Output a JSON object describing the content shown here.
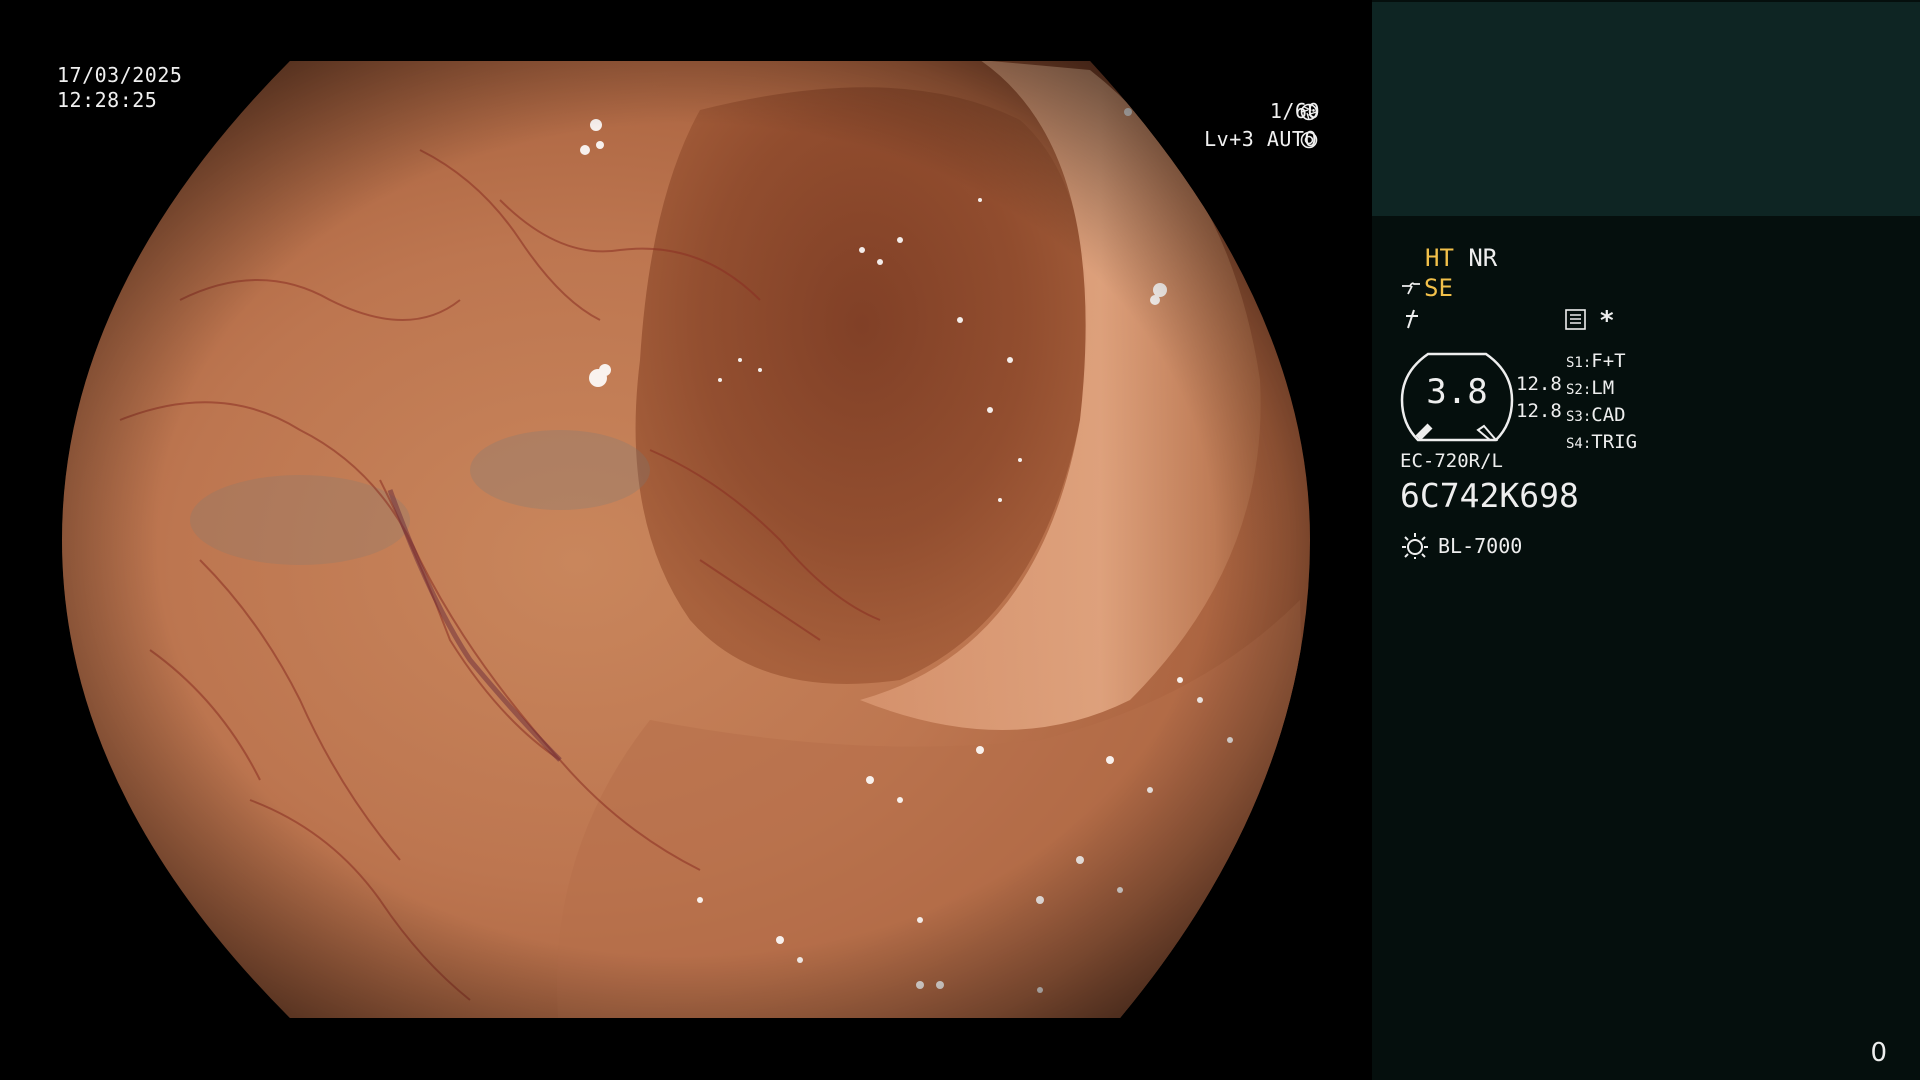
{
  "overlay": {
    "date": "17/03/2025",
    "time": "12:28:25",
    "shutter": "1/60",
    "shutter_icon": "aperture-icon",
    "level": "Lv+3",
    "exposure_mode": "AUTO",
    "exposure_icon": "iris-icon"
  },
  "status_panel": {
    "ht_label": "HT",
    "nr_label": "NR",
    "se_label": "SE",
    "gauge_value": "3.8",
    "gauge_side_1": "12.8",
    "gauge_side_2": "12.8",
    "scope_presets": [
      {
        "key": "S1:",
        "value": "F+T"
      },
      {
        "key": "S2:",
        "value": "LM"
      },
      {
        "key": "S3:",
        "value": "CAD"
      },
      {
        "key": "S4:",
        "value": "TRIG"
      }
    ],
    "asterisk": "*",
    "scope_model": "EC-720R/L",
    "scope_serial": "6C742K698",
    "light_source": "BL-7000",
    "frame_counter": "0"
  },
  "colors": {
    "panel_bg": "#050f0d",
    "panel_top_bg": "#0e2523",
    "accent_orange": "#f2c04a"
  }
}
